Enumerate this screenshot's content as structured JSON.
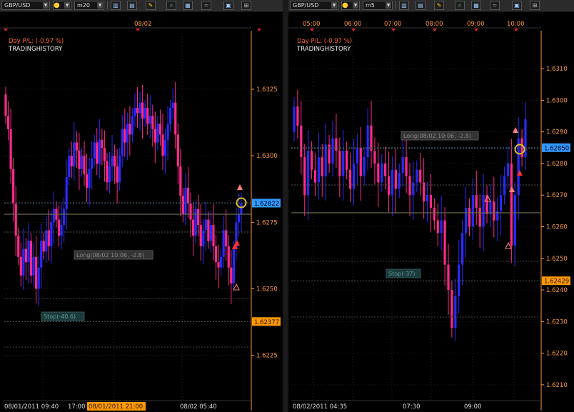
{
  "left_panel": {
    "symbol": "GBP/USD",
    "timeframe": "m20",
    "day_pl": "Day P/L: (-0.97 %)",
    "watermark": "TRADINGHISTORY",
    "top_date": "08/02",
    "current_price": "1.62822",
    "level_price": "1.62377",
    "long_label": "Long(08/02 10:06, -2.8)",
    "stop_label": "Stop(-40.6)",
    "price_ticks": [
      "1.6325",
      "1.6300",
      "1.6275",
      "1.6250",
      "1.6225"
    ],
    "time_labels": [
      "08/01/2011 09:40",
      "17:00",
      "08/01/2011 21:00",
      "08/02 05:40"
    ]
  },
  "right_panel": {
    "symbol": "GBP/USD",
    "timeframe": "m5",
    "day_pl": "Day P/L: (-0.97 %)",
    "watermark": "TRADINGHISTORY",
    "top_times": [
      "05:00",
      "06:00",
      "07:00",
      "08:00",
      "09:00",
      "10:00"
    ],
    "current_price": "1.62850",
    "level_price": "1.62429",
    "long_label": "Long(08/02 10:06, -2.8)",
    "stop_label": "Stop(-37)",
    "price_ticks": [
      "1.6310",
      "1.6300",
      "1.6290",
      "1.6280",
      "1.6270",
      "1.6260",
      "1.6250",
      "1.6240",
      "1.6230",
      "1.6220",
      "1.6210"
    ],
    "time_labels": [
      "08/02/2011 04:35",
      "07:30",
      "09:00"
    ]
  },
  "colors": {
    "bull": "#2a2aff",
    "bear": "#ff2a8c",
    "current_price_bg": "#3399ff",
    "level_price_bg": "#ff9900",
    "axis_text": "#ff9933",
    "label_text": "#cccccc"
  },
  "chart_data": [
    {
      "type": "candlestick",
      "title": "",
      "symbol": "GBP/USD",
      "timeframe": "m20",
      "ylim": [
        1.6208,
        1.6347
      ],
      "grid": true,
      "x_labels": [
        "08/01/2011 09:40",
        "17:00",
        "08/01/2011 21:00",
        "08/02 05:40"
      ],
      "y_ticks": [
        1.6325,
        1.63,
        1.6275,
        1.625,
        1.6225
      ],
      "current_price": 1.62822,
      "level_price": 1.62377,
      "close": [
        1.6315,
        1.631,
        1.6295,
        1.6282,
        1.627,
        1.6262,
        1.6255,
        1.6265,
        1.626,
        1.6268,
        1.6255,
        1.6262,
        1.625,
        1.6258,
        1.6268,
        1.6264,
        1.6272,
        1.6266,
        1.6275,
        1.628,
        1.6276,
        1.627,
        1.6274,
        1.628,
        1.6292,
        1.63,
        1.6296,
        1.6305,
        1.6302,
        1.6295,
        1.63,
        1.6293,
        1.6288,
        1.6295,
        1.6299,
        1.6305,
        1.6297,
        1.6306,
        1.6303,
        1.6298,
        1.629,
        1.6296,
        1.63,
        1.6296,
        1.629,
        1.63,
        1.631,
        1.6305,
        1.6312,
        1.6308,
        1.6315,
        1.6318,
        1.6316,
        1.632,
        1.6314,
        1.6318,
        1.6312,
        1.6315,
        1.631,
        1.6305,
        1.6312,
        1.6308,
        1.63,
        1.6306,
        1.6312,
        1.6318,
        1.632,
        1.6308,
        1.6296,
        1.6285,
        1.6278,
        1.6288,
        1.6282,
        1.6276,
        1.627,
        1.628,
        1.6274,
        1.6266,
        1.6272,
        1.6276,
        1.6268,
        1.6274,
        1.6266,
        1.626,
        1.6258,
        1.6262,
        1.6272,
        1.6266,
        1.6258,
        1.6252,
        1.6265,
        1.6275,
        1.6278,
        1.6282
      ]
    },
    {
      "type": "candlestick",
      "title": "",
      "symbol": "GBP/USD",
      "timeframe": "m5",
      "ylim": [
        1.6205,
        1.6322
      ],
      "grid": true,
      "x_labels": [
        "08/02/2011 04:35",
        "07:30",
        "09:00"
      ],
      "top_time_labels": [
        "05:00",
        "06:00",
        "07:00",
        "08:00",
        "09:00",
        "10:00"
      ],
      "y_ticks": [
        1.631,
        1.63,
        1.629,
        1.628,
        1.627,
        1.626,
        1.625,
        1.624,
        1.623,
        1.622,
        1.621
      ],
      "current_price": 1.6285,
      "level_price": 1.62429,
      "close": [
        1.6298,
        1.6292,
        1.6282,
        1.627,
        1.6284,
        1.6278,
        1.6274,
        1.6282,
        1.6276,
        1.6286,
        1.628,
        1.6288,
        1.6284,
        1.6276,
        1.6284,
        1.6278,
        1.6272,
        1.628,
        1.6285,
        1.6276,
        1.6282,
        1.6292,
        1.6284,
        1.628,
        1.6274,
        1.628,
        1.6276,
        1.627,
        1.6278,
        1.6272,
        1.6277,
        1.6282,
        1.6276,
        1.627,
        1.6274,
        1.6278,
        1.6274,
        1.6268,
        1.627,
        1.6266,
        1.6262,
        1.6258,
        1.6262,
        1.6248,
        1.624,
        1.6228,
        1.6238,
        1.6248,
        1.6258,
        1.6266,
        1.626,
        1.627,
        1.6266,
        1.626,
        1.627,
        1.6264,
        1.6268,
        1.6262,
        1.6265,
        1.627,
        1.6276,
        1.628,
        1.6254,
        1.627,
        1.6288,
        1.6282,
        1.6294
      ]
    }
  ]
}
